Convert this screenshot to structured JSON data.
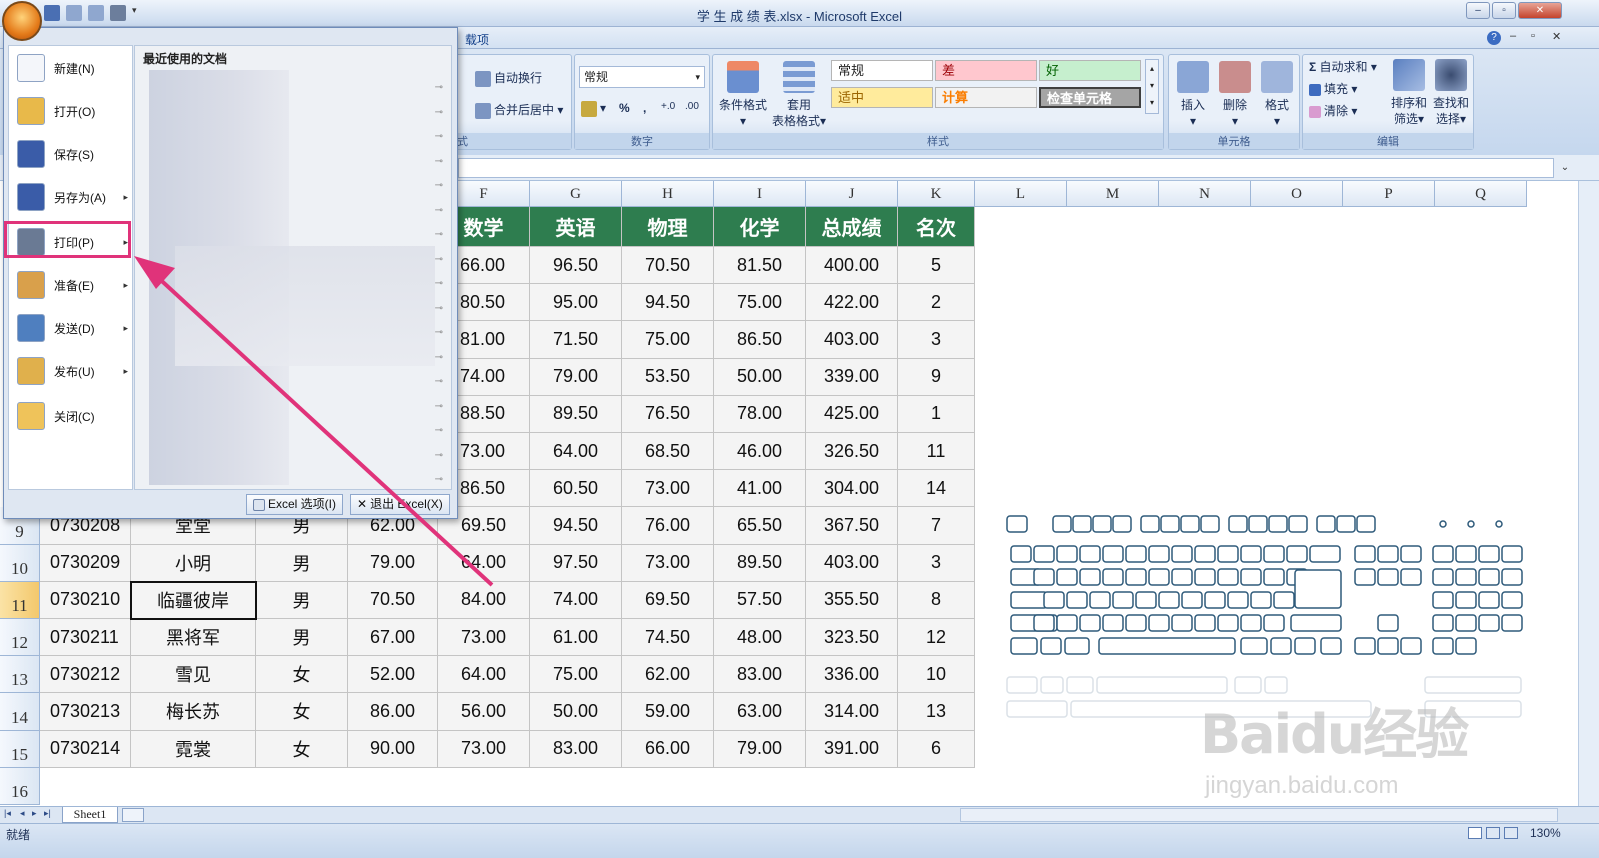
{
  "window": {
    "title": "学 生 成 绩 表.xlsx - Microsoft Excel"
  },
  "ribbon": {
    "visible_tab": "载项",
    "alignment": {
      "wrap_label": "自动换行",
      "merge_label": "合并后居中",
      "group_label": "式"
    },
    "number": {
      "format_value": "常规",
      "percent_label": "%",
      "comma_label": ",",
      "group_label": "数字"
    },
    "styles": {
      "conditional_label": "条件格式",
      "table_label": "套用",
      "table_label2": "表格格式",
      "cells": [
        {
          "label": "常规",
          "bg": "#ffffff"
        },
        {
          "label": "差",
          "bg": "#ffc7ce",
          "fg": "#9c0006"
        },
        {
          "label": "好",
          "bg": "#c6efce",
          "fg": "#006100"
        },
        {
          "label": "适中",
          "bg": "#ffeb9c",
          "fg": "#9c6500"
        },
        {
          "label": "计算",
          "bg": "#f2f2f2",
          "fg": "#fa7d00"
        },
        {
          "label": "检查单元格",
          "bg": "#a5a5a5",
          "fg": "#ffffff"
        }
      ],
      "group_label": "样式"
    },
    "cells_group": {
      "insert_label": "插入",
      "delete_label": "删除",
      "format_label": "格式",
      "group_label": "单元格"
    },
    "editing": {
      "autosum_label": "自动求和",
      "fill_label": "填充",
      "clear_label": "清除",
      "sort_label": "排序和",
      "sort_label2": "筛选",
      "find_label": "查找和",
      "find_label2": "选择",
      "group_label": "编辑"
    }
  },
  "office_menu": {
    "items": [
      {
        "label": "新建(N)",
        "icon": "new-document-icon"
      },
      {
        "label": "打开(O)",
        "icon": "open-folder-icon"
      },
      {
        "label": "保存(S)",
        "icon": "save-disk-icon"
      },
      {
        "label": "另存为(A)",
        "icon": "save-as-icon"
      },
      {
        "label": "打印(P)",
        "icon": "printer-icon"
      },
      {
        "label": "准备(E)",
        "icon": "prepare-icon"
      },
      {
        "label": "发送(D)",
        "icon": "send-icon"
      },
      {
        "label": "发布(U)",
        "icon": "publish-icon"
      },
      {
        "label": "关闭(C)",
        "icon": "close-folder-icon"
      }
    ],
    "recent_title": "最近使用的文档",
    "options_button": "Excel 选项(I)",
    "exit_button": "退出 Excel(X)"
  },
  "grid": {
    "columns": [
      "F",
      "G",
      "H",
      "I",
      "J",
      "K",
      "L",
      "M",
      "N",
      "O",
      "P",
      "Q"
    ],
    "header_row": [
      "数学",
      "英语",
      "物理",
      "化学",
      "总成绩",
      "名次"
    ],
    "upper_rows": [
      [
        "66.00",
        "96.50",
        "70.50",
        "81.50",
        "400.00",
        "5"
      ],
      [
        "80.50",
        "95.00",
        "94.50",
        "75.00",
        "422.00",
        "2"
      ],
      [
        "81.00",
        "71.50",
        "75.00",
        "86.50",
        "403.00",
        "3"
      ],
      [
        "74.00",
        "79.00",
        "53.50",
        "50.00",
        "339.00",
        "9"
      ],
      [
        "88.50",
        "89.50",
        "76.50",
        "78.00",
        "425.00",
        "1"
      ],
      [
        "73.00",
        "64.00",
        "68.50",
        "46.00",
        "326.50",
        "11"
      ],
      [
        "86.50",
        "60.50",
        "73.00",
        "41.00",
        "304.00",
        "14"
      ]
    ],
    "full_rows": [
      {
        "row": "9",
        "cells": [
          "0730208",
          "堂堂",
          "男",
          "62.00",
          "69.50",
          "94.50",
          "76.00",
          "65.50",
          "367.50",
          "7"
        ]
      },
      {
        "row": "10",
        "cells": [
          "0730209",
          "小明",
          "男",
          "79.00",
          "64.00",
          "97.50",
          "73.00",
          "89.50",
          "403.00",
          "3"
        ]
      },
      {
        "row": "11",
        "cells": [
          "0730210",
          "临疆彼岸",
          "男",
          "70.50",
          "84.00",
          "74.00",
          "69.50",
          "57.50",
          "355.50",
          "8"
        ]
      },
      {
        "row": "12",
        "cells": [
          "0730211",
          "黑将军",
          "男",
          "67.00",
          "73.00",
          "61.00",
          "74.50",
          "48.00",
          "323.50",
          "12"
        ]
      },
      {
        "row": "13",
        "cells": [
          "0730212",
          "雪见",
          "女",
          "52.00",
          "64.00",
          "75.00",
          "62.00",
          "83.00",
          "336.00",
          "10"
        ]
      },
      {
        "row": "14",
        "cells": [
          "0730213",
          "梅长苏",
          "女",
          "86.00",
          "56.00",
          "50.00",
          "59.00",
          "63.00",
          "314.00",
          "13"
        ]
      },
      {
        "row": "15",
        "cells": [
          "0730214",
          "霓裳",
          "女",
          "90.00",
          "73.00",
          "83.00",
          "66.00",
          "79.00",
          "391.00",
          "6"
        ]
      }
    ],
    "last_row": "16",
    "header_green": "#2e7d4f"
  },
  "sheet_tab": "Sheet1",
  "status": {
    "ready": "就绪",
    "zoom": "130%"
  },
  "watermark": {
    "text": "Baidu经验",
    "url": "jingyan.baidu.com"
  },
  "highlight_color": "#e0337a"
}
